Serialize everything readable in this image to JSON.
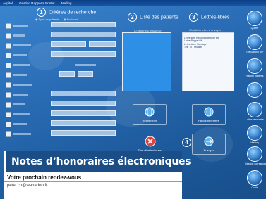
{
  "window": {
    "menu": [
      "Aspitol",
      "Gestion Rapports Printer",
      "Mailing"
    ]
  },
  "panel1": {
    "number": "1",
    "title": "Critères de recherche",
    "radio_a": "Type de patients",
    "radio_b": "Fusionné"
  },
  "panel2": {
    "number": "2",
    "title": "Liste des patients",
    "subtitle": "(0 patient(s) trouvé(s))",
    "button1": "Rechercher",
    "button2": "Tout désélectionner"
  },
  "panel3": {
    "number": "3",
    "title": "Lettres-libres",
    "subtitle": "Choisir la lettre à envoyer",
    "items": [
      "Lettre libre Redondance pour site",
      "Lettre Rappel OK",
      "Lettre Libre Sondage",
      "Test TTT relation"
    ],
    "button1": "Parcourir fenêtre"
  },
  "panel4": {
    "number": "4",
    "button": "Envoyer"
  },
  "sidebar": {
    "items": [
      "Quitter",
      "Evaluation ITAF",
      "Rappel patients",
      "",
      "Lettre-rencontre",
      "Mailing",
      "Gestion correspondants",
      "Outils"
    ]
  },
  "banner": {
    "text": "Notes d’honoraires électroniques"
  },
  "appointment": {
    "title": "Votre prochain rendez-vous",
    "email": "peter.co@wanadoo.fr"
  }
}
